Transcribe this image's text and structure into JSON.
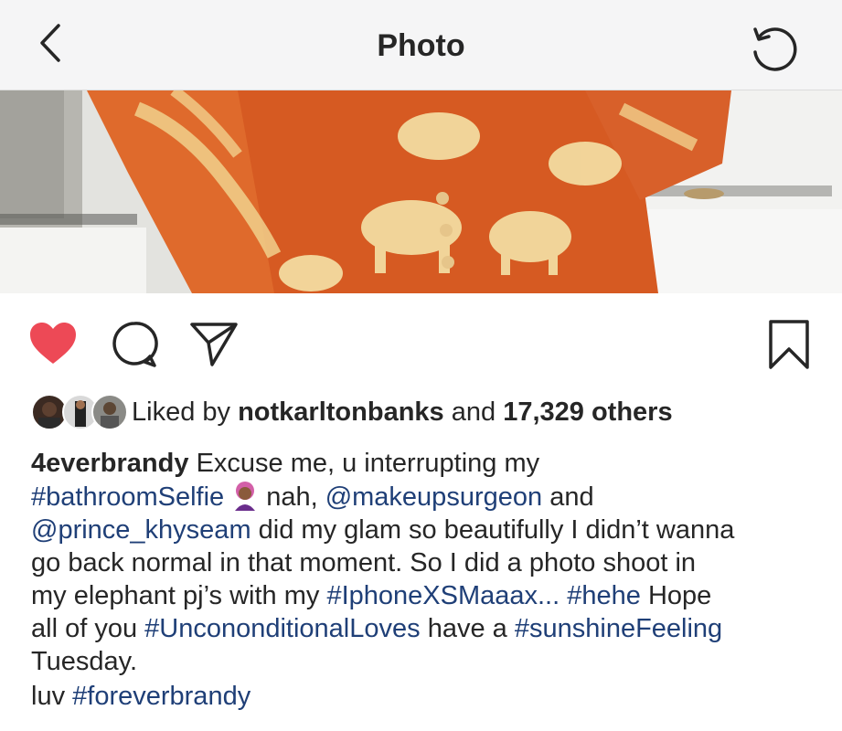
{
  "header": {
    "title": "Photo",
    "back_icon": "chevron-left-icon",
    "refresh_icon": "refresh-icon"
  },
  "photo": {
    "description_icon": "post-photo"
  },
  "actions": {
    "like_icon": "heart-filled-icon",
    "comment_icon": "comment-icon",
    "share_icon": "send-icon",
    "save_icon": "bookmark-icon",
    "like_color": "#ed4956"
  },
  "likes": {
    "prefix": "Liked by",
    "user": "notkarltonbanks",
    "middle": "and",
    "count": "17,329 others"
  },
  "caption": {
    "username": "4everbrandy",
    "line1_text": "Excuse me, u interrupting my",
    "hashtag_bathroom": "#bathroomSelfie",
    "emoji_name": "woman-emoji",
    "text_nah": "nah,",
    "mention_makeup": "@makeupsurgeon",
    "text_and": "and",
    "mention_prince": "@prince_khyseam",
    "text_glam": "did my glam so beautifully I didn’t wanna",
    "line4": "go back normal in that moment. So I did a photo shoot in",
    "text_elephant": "my elephant pj’s with my",
    "hashtag_iphone": "#IphoneXSMaaax...",
    "hashtag_hehe": "#hehe",
    "text_hope": "Hope",
    "text_all": "all of you",
    "hashtag_uncon": "#Uncononditional",
    "hashtag_loves": "Loves",
    "text_have": "have a",
    "hashtag_sunshine": "#sunshineFeeling",
    "line7": "Tuesday.",
    "text_luv": "luv",
    "hashtag_forever": "#foreverbrandy"
  },
  "link_color": "#1f3f77"
}
